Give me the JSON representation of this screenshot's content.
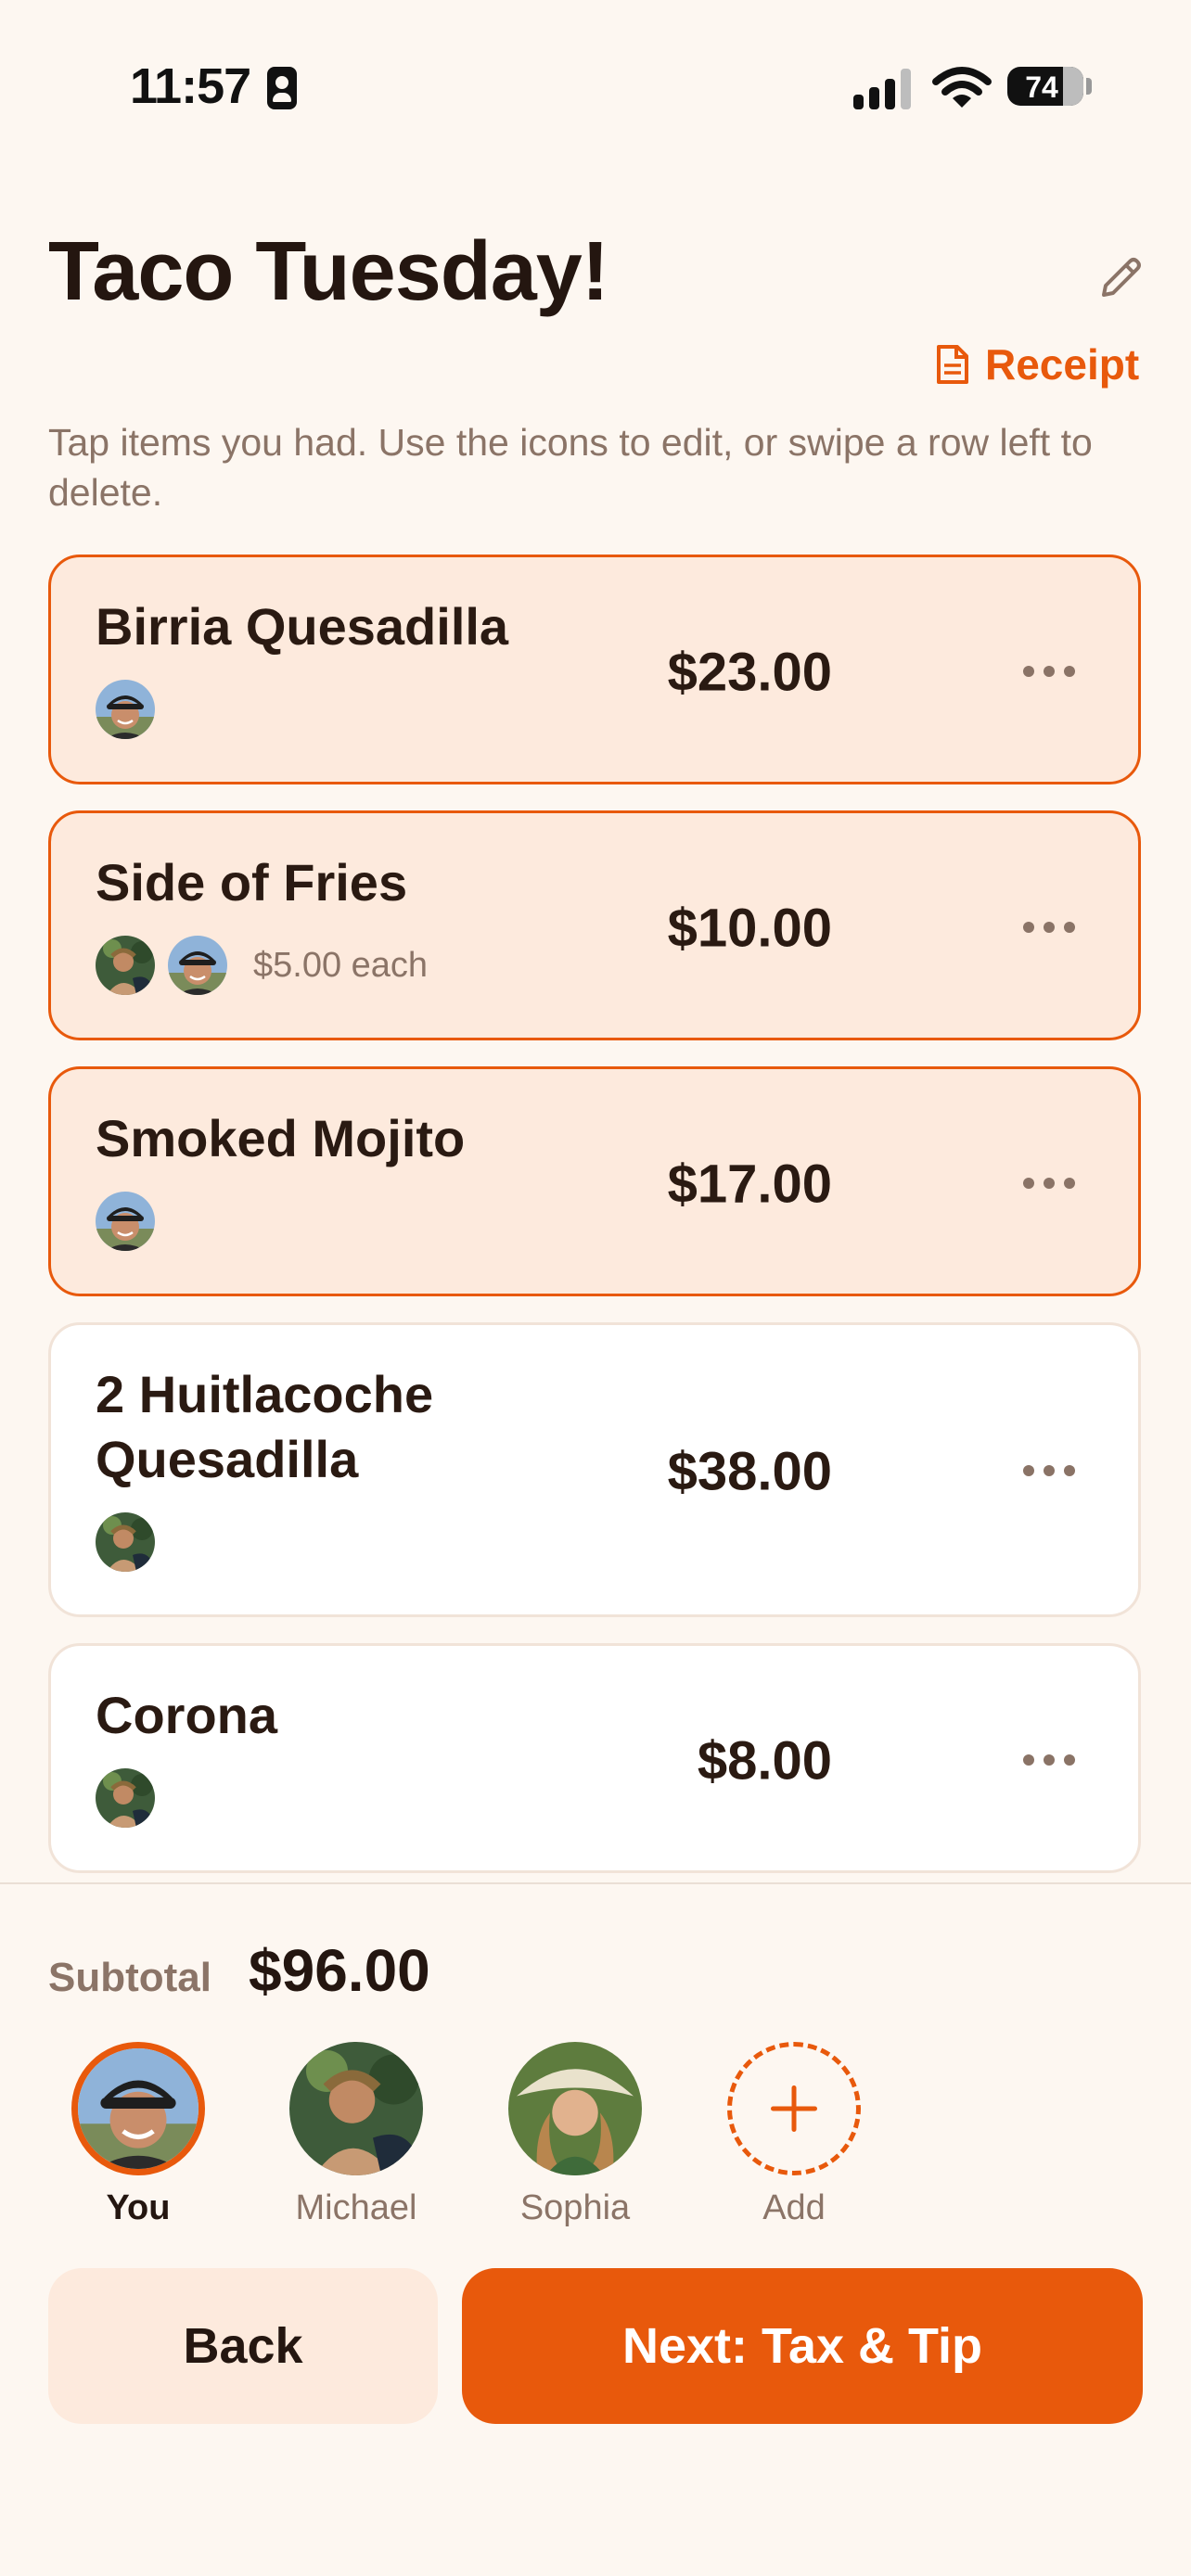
{
  "status_bar": {
    "time": "11:57",
    "battery": "74"
  },
  "header": {
    "title": "Taco Tuesday!",
    "receipt_label": "Receipt"
  },
  "hint": "Tap items you had. Use the icons to edit, or swipe a row left to delete.",
  "items": [
    {
      "name": "Birria Quesadilla",
      "price": "$23.00",
      "selected": true,
      "assignees": [
        "You"
      ],
      "each": ""
    },
    {
      "name": "Side of Fries",
      "price": "$10.00",
      "selected": true,
      "assignees": [
        "Michael",
        "You"
      ],
      "each": "$5.00 each"
    },
    {
      "name": "Smoked Mojito",
      "price": "$17.00",
      "selected": true,
      "assignees": [
        "You"
      ],
      "each": ""
    },
    {
      "name_line1": "2 Huitlacoche",
      "name_line2": "Quesadilla",
      "price": "$38.00",
      "selected": false,
      "assignees": [
        "Michael"
      ],
      "each": ""
    },
    {
      "name": "Corona",
      "price": "$8.00",
      "selected": false,
      "assignees": [
        "Michael"
      ],
      "each": ""
    }
  ],
  "subtotal": {
    "label": "Subtotal",
    "value": "$96.00"
  },
  "people": [
    {
      "name": "You",
      "active": true
    },
    {
      "name": "Michael",
      "active": false
    },
    {
      "name": "Sophia",
      "active": false
    },
    {
      "name": "Add",
      "active": false
    }
  ],
  "actions": {
    "back_label": "Back",
    "next_label": "Next: Tax & Tip"
  },
  "colors": {
    "accent": "#E8590C",
    "selected_bg": "#FDEADD",
    "background": "#FDF7F1",
    "text": "#2A1A12",
    "muted": "#8B7467"
  }
}
